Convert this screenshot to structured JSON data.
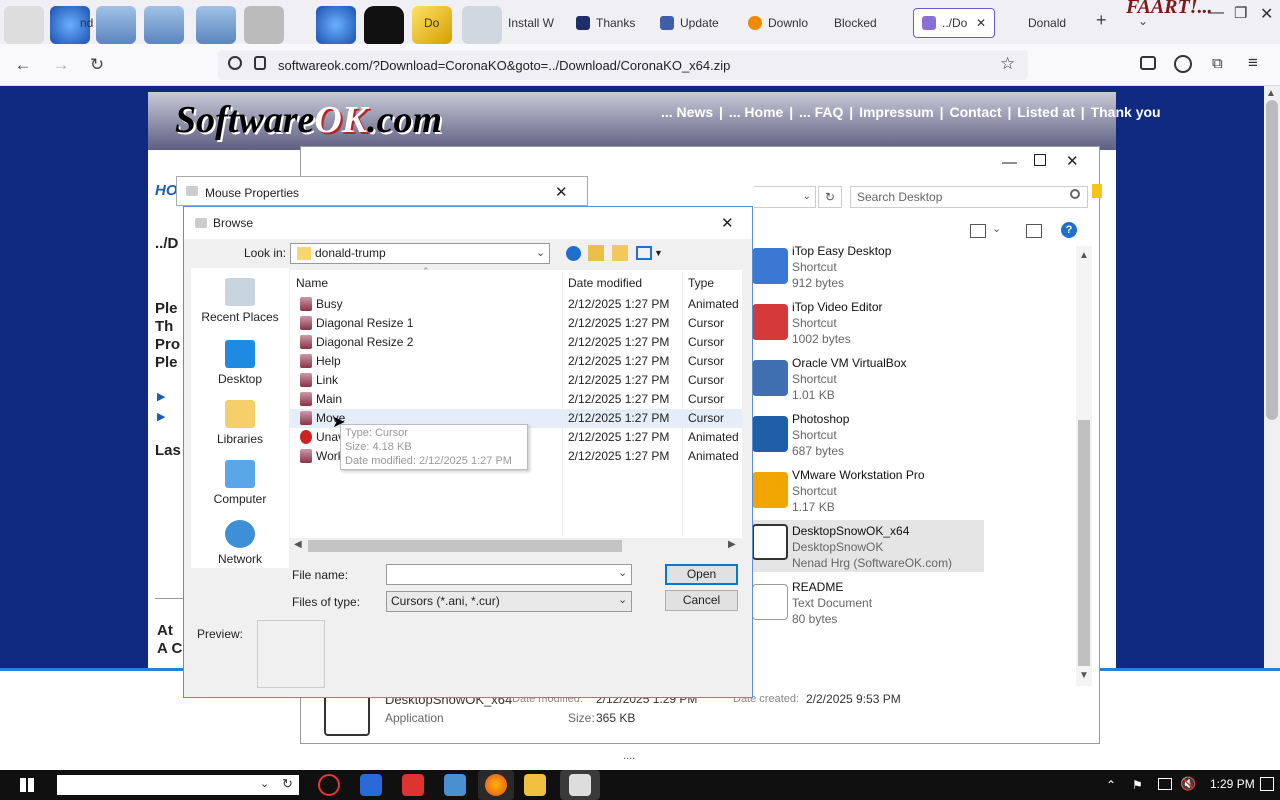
{
  "browser": {
    "desktop_icons": [
      "hand-pointer-icon",
      "globe-icon",
      "folder-icon",
      "folder-icon",
      "folder-icon",
      "folder-icon",
      "tools-icon",
      "globe-icon",
      "tshirt-icon",
      "brush-icon",
      "recycle-bin-icon"
    ],
    "tabs": [
      {
        "label": "Install W",
        "icon": "page-icon"
      },
      {
        "label": "Thanks",
        "icon": "shield-icon"
      },
      {
        "label": "Update",
        "icon": "page-icon"
      },
      {
        "label": "Downlo",
        "icon": "download-icon"
      },
      {
        "label": "Blocked",
        "icon": ""
      },
      {
        "label": "../Do",
        "icon": "page-icon",
        "active": true
      },
      {
        "label": "Donald",
        "icon": ""
      }
    ],
    "partial_tabs": [
      "nd",
      "Do"
    ],
    "new_tab_label": "+",
    "url": "softwareok.com/?Download=CoronaKO&goto=../Download/CoronaKO_x64.zip",
    "faart_logo_text": "FAART!..."
  },
  "site": {
    "logo_part1": "Software",
    "logo_part2": "OK",
    "logo_part3": ".com",
    "nav": [
      "... News",
      "|",
      "... Home",
      "|",
      "... FAQ",
      "|",
      "Impressum",
      "|",
      "Contact",
      "|",
      "Listed at",
      "|",
      "Thank you"
    ],
    "left_fragments": [
      "HO",
      "../D",
      "Ple",
      "Th",
      "Pro",
      "Ple",
      "▶",
      "▶",
      "Las",
      "At",
      "A C"
    ]
  },
  "explorer": {
    "search_placeholder": "Search Desktop",
    "items": [
      {
        "name": "iTop Easy Desktop",
        "type": "Shortcut",
        "size": "912 bytes",
        "icon": "itop-easy-desktop-icon",
        "color": "#3a78d4"
      },
      {
        "name": "iTop Video Editor",
        "type": "Shortcut",
        "size": "1002 bytes",
        "icon": "itop-video-editor-icon",
        "color": "#d43a3a"
      },
      {
        "name": "Oracle VM VirtualBox",
        "type": "Shortcut",
        "size": "1.01 KB",
        "icon": "virtualbox-icon",
        "color": "#3f6fb0"
      },
      {
        "name": "Photoshop",
        "type": "Shortcut",
        "size": "687 bytes",
        "icon": "photoshop-icon",
        "color": "#1f5fa8"
      },
      {
        "name": "VMware Workstation Pro",
        "type": "Shortcut",
        "size": "1.17 KB",
        "icon": "vmware-icon",
        "color": "#f0a500"
      },
      {
        "name": "DesktopSnowOK_x64",
        "type": "DesktopSnowOK",
        "size": "Nenad Hrg (SoftwareOK.com)",
        "icon": "snowflake-icon",
        "color": "#ffffff",
        "selected": true
      },
      {
        "name": "README",
        "type": "Text Document",
        "size": "80 bytes",
        "icon": "text-document-icon",
        "color": "#ffffff"
      }
    ],
    "details": {
      "name": "DesktopSnowOK_x64",
      "modified_label": "Date modified:",
      "modified_value": "2/12/2025 1:29 PM",
      "created_label": "Date created:",
      "created_value": "2/2/2025 9:53 PM",
      "type": "Application",
      "size_label": "Size:",
      "size_value": "365 KB"
    }
  },
  "mouse_properties": {
    "title": "Mouse Properties"
  },
  "browse": {
    "title": "Browse",
    "look_in_label": "Look in:",
    "look_in_value": "donald-trump",
    "places": [
      "Recent Places",
      "Desktop",
      "Libraries",
      "Computer",
      "Network"
    ],
    "columns": [
      "Name",
      "Date modified",
      "Type"
    ],
    "files": [
      {
        "name": "Busy",
        "date": "2/12/2025 1:27 PM",
        "type": "Animated"
      },
      {
        "name": "Diagonal Resize 1",
        "date": "2/12/2025 1:27 PM",
        "type": "Cursor"
      },
      {
        "name": "Diagonal Resize 2",
        "date": "2/12/2025 1:27 PM",
        "type": "Cursor"
      },
      {
        "name": "Help",
        "date": "2/12/2025 1:27 PM",
        "type": "Cursor"
      },
      {
        "name": "Link",
        "date": "2/12/2025 1:27 PM",
        "type": "Cursor"
      },
      {
        "name": "Main",
        "date": "2/12/2025 1:27 PM",
        "type": "Cursor"
      },
      {
        "name": "Move",
        "date": "2/12/2025 1:27 PM",
        "type": "Cursor"
      },
      {
        "name": "Unavailable",
        "date": "2/12/2025 1:27 PM",
        "type": "Animated"
      },
      {
        "name": "Working in Background",
        "date": "2/12/2025 1:27 PM",
        "type": "Animated"
      }
    ],
    "tooltip": {
      "type": "Type: Cursor",
      "size": "Size: 4.18 KB",
      "modified": "Date modified: 2/12/2025 1:27 PM"
    },
    "file_name_label": "File name:",
    "file_name_value": "",
    "file_type_label": "Files of type:",
    "file_type_value": "Cursors (*.ani, *.cur)",
    "open_label": "Open",
    "cancel_label": "Cancel",
    "preview_label": "Preview:"
  },
  "taskbar": {
    "time": "1:29 PM",
    "search_value": "",
    "apps": [
      "close-circle-icon",
      "shield-icon",
      "video-icon",
      "terminal-icon",
      "firefox-icon",
      "file-explorer-icon",
      "cursor-app-icon"
    ],
    "ellipsis": "...."
  }
}
